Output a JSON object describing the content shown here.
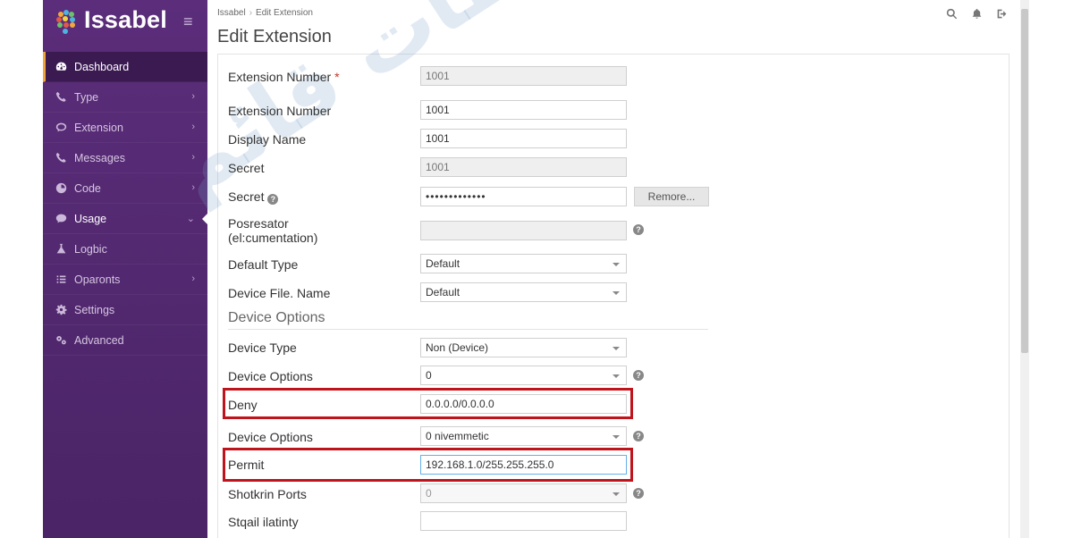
{
  "app": {
    "name": "Issabel"
  },
  "breadcrumb": {
    "root": "Issabel",
    "current": "Edit Extension"
  },
  "page_title": "Edit Extension",
  "sidebar": {
    "items": [
      {
        "label": "Dashboard",
        "icon": "dashboard-icon",
        "active": true
      },
      {
        "label": "Type",
        "icon": "phone-icon"
      },
      {
        "label": "Extension",
        "icon": "chat-icon"
      },
      {
        "label": "Messages",
        "icon": "phone-icon"
      },
      {
        "label": "Code",
        "icon": "gauge-icon"
      },
      {
        "label": "Usage",
        "icon": "comment-icon",
        "open": true
      },
      {
        "label": "Logbic",
        "icon": "flask-icon"
      },
      {
        "label": "Oparonts",
        "icon": "list-icon"
      },
      {
        "label": "Settings",
        "icon": "gear-icon"
      },
      {
        "label": "Advanced",
        "icon": "gears-icon"
      }
    ]
  },
  "form": {
    "extension_number_req": {
      "label": "Extension Number",
      "required": "*",
      "value": "1001"
    },
    "extension_number": {
      "label": "Extension Number",
      "value": "1001"
    },
    "display_name": {
      "label": "Display Name",
      "value": "1001"
    },
    "secret_ro": {
      "label": "Secret",
      "value": "1001"
    },
    "secret": {
      "label": "Secret",
      "value": "•••••••••••••",
      "remove_label": "Remore..."
    },
    "posresator": {
      "label_line1": "Posresator",
      "label_line2": "(el:cumentation)",
      "value": ""
    },
    "default_type": {
      "label": "Default Type",
      "value": "Default"
    },
    "device_file_name": {
      "label": "Device File. Name",
      "value": "Default"
    },
    "section_device_options": "Device Options",
    "device_type": {
      "label": "Device Type",
      "value": "Non (Device)"
    },
    "device_options_1": {
      "label": "Device Options",
      "value": "0"
    },
    "deny": {
      "label": "Deny",
      "value": "0.0.0.0/0.0.0.0"
    },
    "device_options_2": {
      "label": "Device Options",
      "value": "0 nivemmetic"
    },
    "permit": {
      "label": "Permit",
      "value": "192.168.1.0/255.255.255.0"
    },
    "shotkrin_ports": {
      "label": "Shotkrin Ports",
      "value": "0"
    },
    "stqail": {
      "label": "Stqail ilatinty",
      "value": ""
    }
  },
  "help_glyph": "?",
  "watermark_text": "عصر ارتباطات قائم",
  "colors": {
    "sidebar": "#5b2d7a",
    "highlight": "#c0141c",
    "active_accent": "#f0a43a"
  }
}
